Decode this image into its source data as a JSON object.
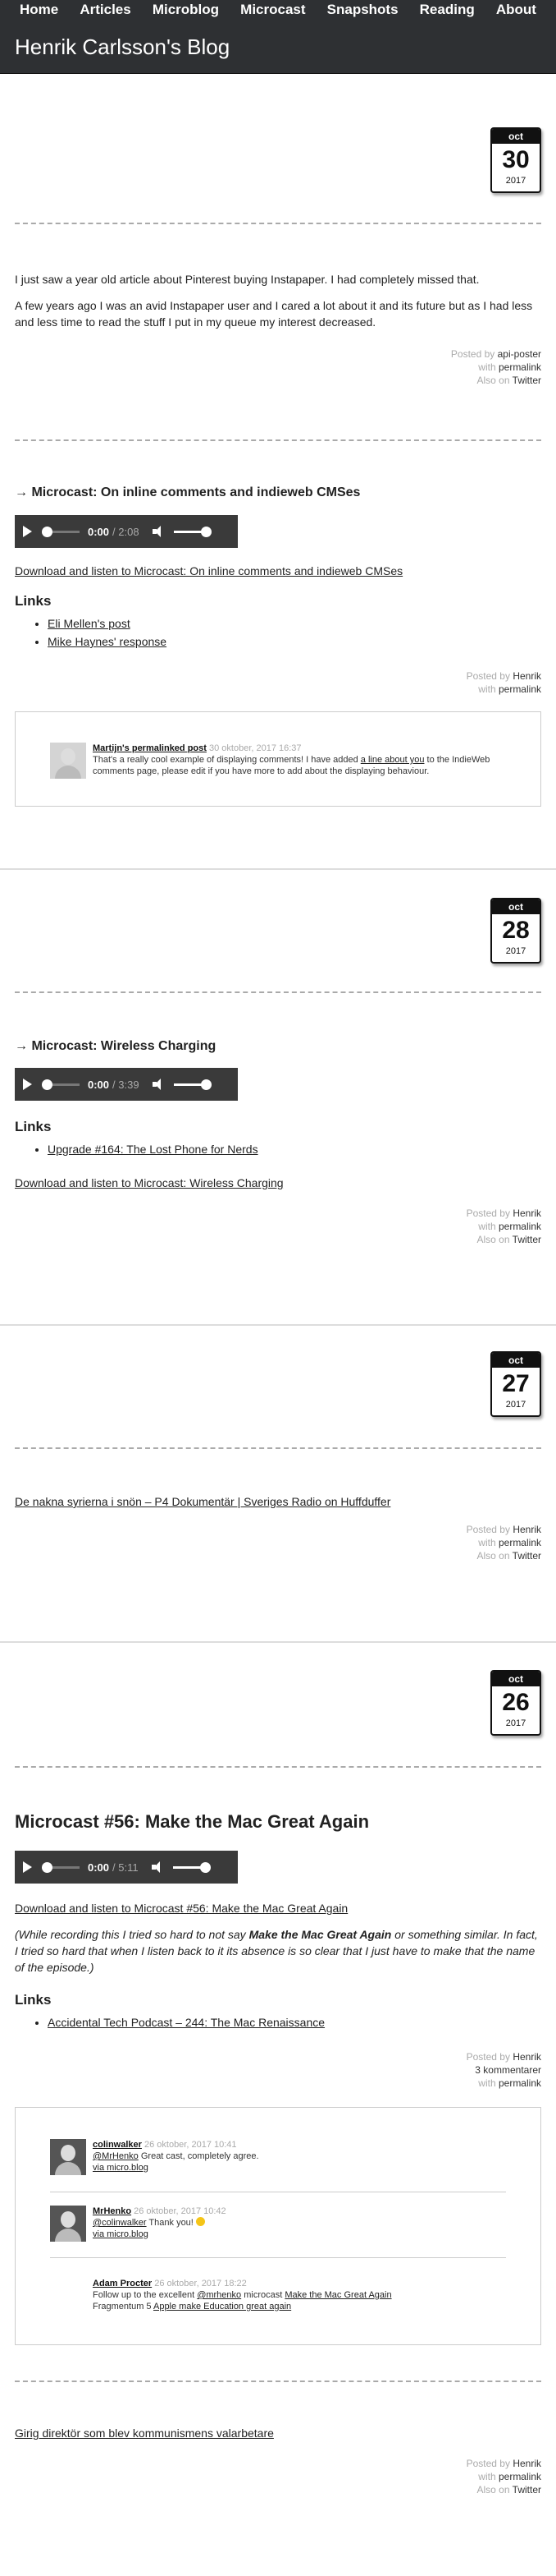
{
  "nav": [
    "Home",
    "Articles",
    "Microblog",
    "Microcast",
    "Snapshots",
    "Reading",
    "About"
  ],
  "site_title": "Henrik Carlsson's Blog",
  "labels": {
    "posted_by": "Posted by",
    "with": "with",
    "also_on": "Also on",
    "permalink": "permalink",
    "twitter": "Twitter",
    "links": "Links"
  },
  "posts": [
    {
      "date": {
        "month": "oct",
        "day": "30",
        "year": "2017"
      },
      "paragraphs": [
        "I just saw a year old article about Pinterest buying Instapaper. I had completely missed that.",
        "A few years ago I was an avid Instapaper user and I cared a lot about it and its future but as I had less and less time to read the stuff I put in my queue my interest decreased."
      ],
      "author": "api-poster"
    },
    {
      "title": "→ Microcast: On inline comments and indieweb CMSes",
      "player": {
        "current": "0:00",
        "duration": "/ 2:08"
      },
      "download": "Download and listen to Microcast: On inline comments and indieweb CMSes",
      "links": [
        "Eli Mellen's post",
        "Mike Haynes' response"
      ],
      "author": "Henrik",
      "comment": {
        "author": "Martijn's permalinked post",
        "when": "30 oktober, 2017 16:37",
        "text_before": "That's a really cool example of displaying comments! I have added ",
        "link": "a line about you",
        "text_after": " to the IndieWeb comments page, please edit if you have more to add about the displaying behaviour."
      }
    },
    {
      "date": {
        "month": "oct",
        "day": "28",
        "year": "2017"
      },
      "title": "→ Microcast: Wireless Charging",
      "player": {
        "current": "0:00",
        "duration": "/ 3:39"
      },
      "links": [
        "Upgrade #164: The Lost Phone for Nerds"
      ],
      "download": "Download and listen to Microcast: Wireless Charging",
      "author": "Henrik"
    },
    {
      "date": {
        "month": "oct",
        "day": "27",
        "year": "2017"
      },
      "link": "De nakna syrierna i snön – P4 Dokumentär | Sveriges Radio on Huffduffer",
      "author": "Henrik"
    },
    {
      "date": {
        "month": "oct",
        "day": "26",
        "year": "2017"
      },
      "title": "Microcast #56: Make the Mac Great Again",
      "player": {
        "current": "0:00",
        "duration": "/ 5:11"
      },
      "download": "Download and listen to Microcast #56: Make the Mac Great Again",
      "note_before": "(While recording this I tried so hard to not say ",
      "note_em": "Make the Mac Great Again",
      "note_after": " or something similar. In fact, I tried so hard that when I listen back to it its absence is so clear that I just have to make that the name of the episode.)",
      "links": [
        "Accidental Tech Podcast – 244: The Mac Renaissance"
      ],
      "author": "Henrik",
      "comments_count": "3 kommentarer",
      "comments": [
        {
          "author": "colinwalker",
          "when": "26 oktober, 2017 10:41",
          "line1_link": "@MrHenko",
          "line1_text": " Great cast, completely agree.",
          "via": "via micro.blog"
        },
        {
          "author": "MrHenko",
          "when": "26 oktober, 2017 10:42",
          "line1_link": "@colinwalker",
          "line1_text": " Thank you!",
          "via": "via micro.blog"
        },
        {
          "author": "Adam Procter",
          "when": "26 oktober, 2017 18:22",
          "line1_pre": "Follow up to the excellent ",
          "line1_link": "@mrhenko",
          "line1_mid": " microcast ",
          "line1_link2": "Make the Mac Great Again",
          "line2_pre": "Fragmentum 5 ",
          "line2_link": "Apple make Education great again"
        }
      ]
    },
    {
      "link": "Girig direktör som blev kommunismens valarbetare",
      "author": "Henrik"
    }
  ]
}
